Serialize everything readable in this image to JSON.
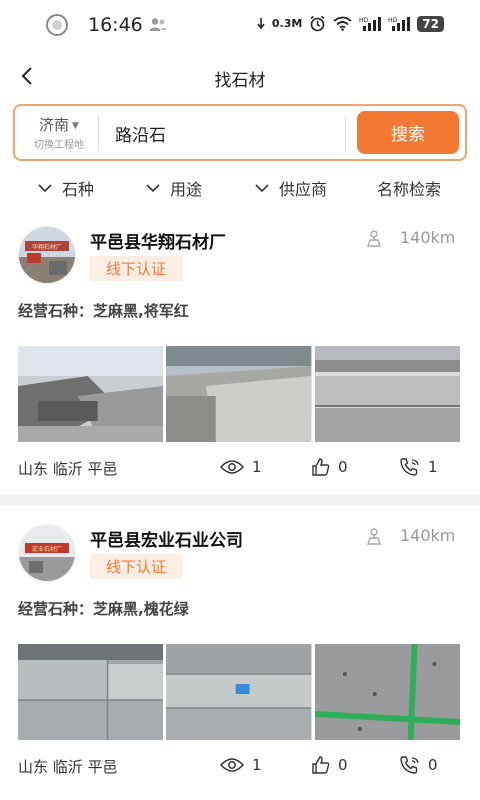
{
  "status_bar": {
    "time": "16:46",
    "net_speed": "0.3M",
    "battery": "72"
  },
  "nav": {
    "title": "找石材"
  },
  "search": {
    "city": "济南",
    "city_sub": "切换工程地",
    "query": "路沿石",
    "button_label": "搜索"
  },
  "filters": {
    "stone_type": "石种",
    "usage": "用途",
    "supplier": "供应商",
    "name_search": "名称检索"
  },
  "listings": [
    {
      "avatar_sign": "华翔石材厂",
      "company": "平邑县华翔石材厂",
      "cert": "线下认证",
      "distance": "140km",
      "stone_types": "经营石种：芝麻黑,将军红",
      "location": "山东 临沂 平邑",
      "views": "1",
      "likes": "0",
      "calls": "1"
    },
    {
      "avatar_sign": "宏业石材厂",
      "company": "平邑县宏业石业公司",
      "cert": "线下认证",
      "distance": "140km",
      "stone_types": "经营石种：芝麻黑,槐花绿",
      "location": "山东 临沂 平邑",
      "views": "1",
      "likes": "0",
      "calls": "0"
    }
  ],
  "colors": {
    "accent": "#f47a33",
    "badge_bg": "#fdeee4",
    "badge_text": "#f07a3c"
  }
}
